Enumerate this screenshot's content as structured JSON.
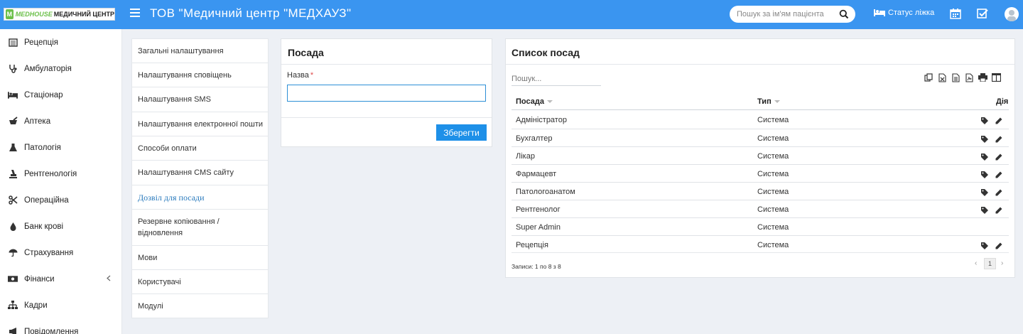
{
  "header": {
    "logo_text_brand": "MEDHOUSE",
    "logo_text_sub": "МЕДИЧНИЙ ЦЕНТР",
    "title": "ТОВ \"Медичний центр \"МЕДХАУЗ\"",
    "search_placeholder": "Пошук за ім'ям пацієнта",
    "bed_status_label": "Статус ліжка",
    "accent_color": "#3a95f0"
  },
  "sidebar": {
    "items": [
      {
        "label": "Рецепція",
        "icon": "reception-icon"
      },
      {
        "label": "Амбулаторія",
        "icon": "stethoscope-icon"
      },
      {
        "label": "Стаціонар",
        "icon": "bed-icon"
      },
      {
        "label": "Аптека",
        "icon": "mortar-pestle-icon"
      },
      {
        "label": "Патологія",
        "icon": "flask-icon"
      },
      {
        "label": "Рентгенологія",
        "icon": "xray-icon"
      },
      {
        "label": "Операційна",
        "icon": "scissors-icon"
      },
      {
        "label": "Банк крові",
        "icon": "blood-drop-icon"
      },
      {
        "label": "Страхування",
        "icon": "umbrella-icon"
      },
      {
        "label": "Фінанси",
        "icon": "money-icon"
      },
      {
        "label": "Кадри",
        "icon": "sitemap-icon"
      },
      {
        "label": "Повідомлення",
        "icon": "bullhorn-icon"
      }
    ]
  },
  "settings_menu": {
    "items": [
      "Загальні налаштування",
      "Налаштування сповіщень",
      "Налаштування SMS",
      "Налаштування електронної пошти",
      "Способи оплати",
      "Налаштування CMS сайту",
      "Дозвіл для посади",
      "Резервне копіювання / відновлення",
      "Мови",
      "Користувачі",
      "Модулі"
    ],
    "active_index": 6
  },
  "form": {
    "title": "Посада",
    "name_label": "Назва",
    "required_mark": "*",
    "name_value": "",
    "save_label": "Зберегти",
    "save_color": "#1e90e8"
  },
  "list": {
    "title": "Список посад",
    "search_placeholder": "Пошук...",
    "columns": {
      "position": "Посада",
      "type": "Тип",
      "action": "Дія"
    },
    "rows": [
      {
        "position": "Адміністратор",
        "type": "Система",
        "actions": true
      },
      {
        "position": "Бухгалтер",
        "type": "Система",
        "actions": true
      },
      {
        "position": "Лікар",
        "type": "Система",
        "actions": true
      },
      {
        "position": "Фармацевт",
        "type": "Система",
        "actions": true
      },
      {
        "position": "Патологоанатом",
        "type": "Система",
        "actions": true
      },
      {
        "position": "Рентгенолог",
        "type": "Система",
        "actions": true
      },
      {
        "position": "Super Admin",
        "type": "Система",
        "actions": false
      },
      {
        "position": "Рецепція",
        "type": "Система",
        "actions": true
      }
    ],
    "records_text": "Записи: 1 по 8 з 8",
    "current_page": "1",
    "tools": [
      "copy-icon",
      "excel-icon",
      "csv-icon",
      "pdf-icon",
      "print-icon",
      "columns-icon"
    ]
  }
}
